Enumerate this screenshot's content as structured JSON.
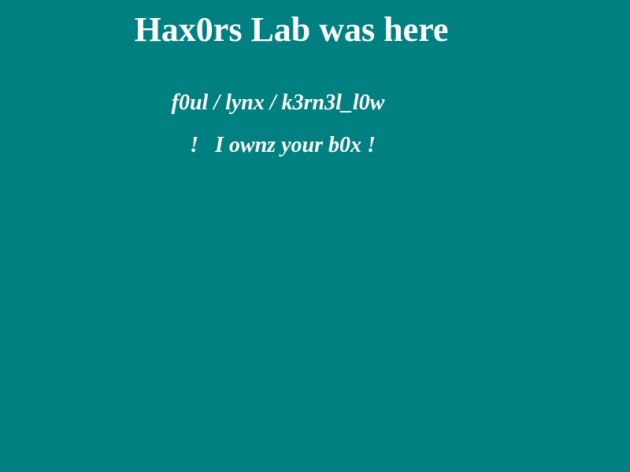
{
  "page": {
    "title": "Hax0rs Lab was here",
    "credits": "f0ul / lynx / k3rn3l_l0w",
    "message": "!   I ownz your b0x !",
    "colors": {
      "background": "#008080",
      "text": "#ffffff"
    }
  }
}
